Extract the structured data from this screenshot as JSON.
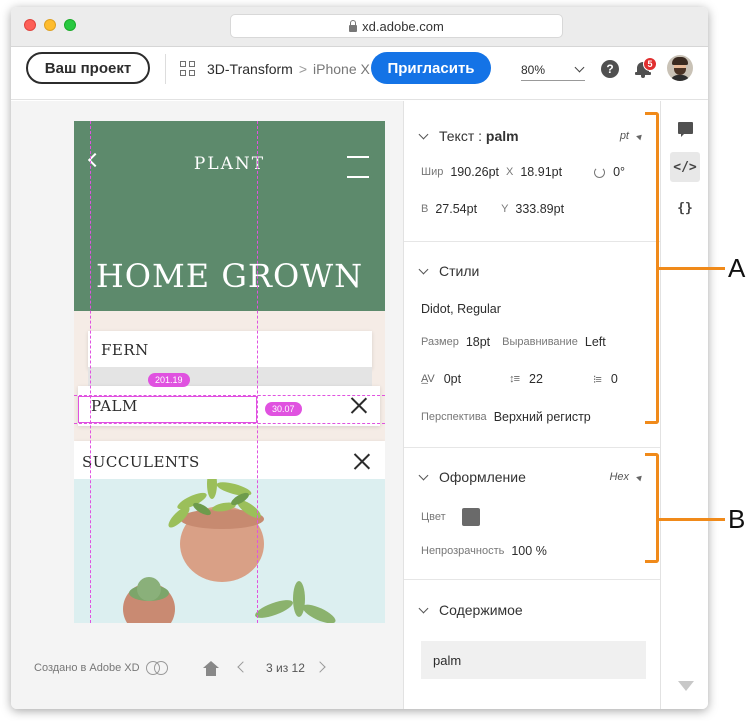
{
  "browser": {
    "url": "xd.adobe.com"
  },
  "toolbar": {
    "project_button": "Ваш проект",
    "breadcrumb": [
      "3D-Transform",
      ">",
      "iPhone X"
    ],
    "invite_button": "Пригласить",
    "zoom": "80%",
    "help": "?",
    "notification_count": "5",
    "accent_color": "#1473e6"
  },
  "artboard": {
    "nav_title": "PLANT",
    "hero_title": "HOME GROWN",
    "cards": [
      "FERN",
      "PALM",
      "SUCCULENTS"
    ],
    "measure_1": "201.19",
    "measure_2": "30.07",
    "hero_color": "#5d8a6c",
    "guide_color": "#e052e0"
  },
  "canvas_footer": {
    "made_with": "Создано в Adobe XD",
    "page_counter": "3 из 12"
  },
  "props": {
    "text": {
      "header_prefix": "Текст : ",
      "header_name": "palm",
      "unit": "pt",
      "width_label": "Шир",
      "width_value": "190.26pt",
      "x_label": "X",
      "x_value": "18.91pt",
      "rotation_value": "0°",
      "height_label": "В",
      "height_value": "27.54pt",
      "y_label": "Y",
      "y_value": "333.89pt"
    },
    "styles": {
      "header": "Стили",
      "font": "Didot, Regular",
      "size_label": "Размер",
      "size_value": "18pt",
      "align_label": "Выравнивание",
      "align_value": "Left",
      "tracking_value": "0pt",
      "line_height_value": "22",
      "para_spacing_value": "0",
      "case_label": "Перспектива",
      "case_value": "Верхний регистр"
    },
    "appearance": {
      "header": "Оформление",
      "format": "Hex",
      "color_label": "Цвет",
      "color_value": "#6a6a6a",
      "opacity_label": "Непрозрачность",
      "opacity_value": "100 %"
    },
    "content": {
      "header": "Содержимое",
      "value": "palm"
    }
  },
  "rail": {
    "code_icon_text": "</>",
    "braces_icon_text": "{}"
  },
  "annotations": {
    "a": "A",
    "b": "B",
    "color": "#f08a1a"
  }
}
